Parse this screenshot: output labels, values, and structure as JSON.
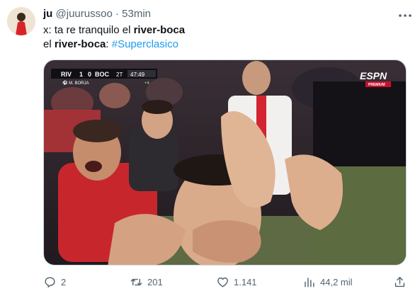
{
  "tweet": {
    "author_name": "ju",
    "handle": "@juurussoo",
    "separator": "·",
    "time": "53min",
    "line1_prefix": "x: ta re tranquilo el ",
    "line1_bold": "river-boca",
    "line2_prefix": "el ",
    "line2_bold": "river-boca",
    "line2_sep": ": ",
    "hashtag": "#Superclasico"
  },
  "media": {
    "scoreboard": {
      "home_team": "RIV",
      "home_score": "1",
      "away_score": "0",
      "away_team": "BOC",
      "period": "2T",
      "clock": "47:49",
      "scorer": "⚽ M. BORJA",
      "added_time": "+4"
    },
    "broadcaster": "ESPN",
    "broadcaster_sub": "PREMIUM"
  },
  "actions": {
    "replies": "2",
    "reposts": "201",
    "likes": "1.141",
    "views": "44,2 mil"
  },
  "colors": {
    "accent": "#1d9bf0",
    "muted": "#536471",
    "border": "#cfd9de"
  },
  "icons": [
    "more-icon",
    "reply-icon",
    "repost-icon",
    "like-icon",
    "views-icon",
    "share-icon"
  ]
}
